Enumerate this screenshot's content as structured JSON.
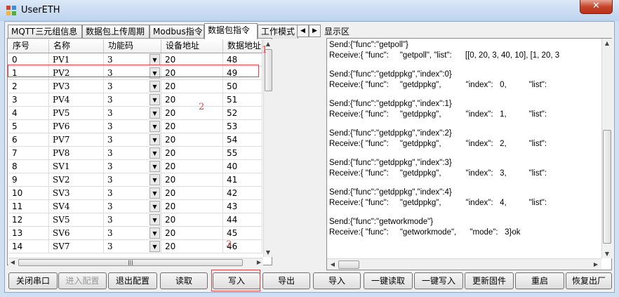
{
  "window": {
    "title": "UserETH",
    "close_label": "✕"
  },
  "tabs": [
    {
      "label": "MQTT三元组信息"
    },
    {
      "label": "数据包上传周期"
    },
    {
      "label": "Modbus指令"
    },
    {
      "label": "数据包指令",
      "active": true
    },
    {
      "label": "工作模式"
    }
  ],
  "tab_scroll": {
    "left": "◀",
    "right": "▶"
  },
  "grid": {
    "columns": [
      "序号",
      "名称",
      "功能码",
      "设备地址",
      "数据地址"
    ],
    "rows": [
      [
        "0",
        "PV1",
        "3",
        "20",
        "48"
      ],
      [
        "1",
        "PV2",
        "3",
        "20",
        "49"
      ],
      [
        "2",
        "PV3",
        "3",
        "20",
        "50"
      ],
      [
        "3",
        "PV4",
        "3",
        "20",
        "51"
      ],
      [
        "4",
        "PV5",
        "3",
        "20",
        "52"
      ],
      [
        "5",
        "PV6",
        "3",
        "20",
        "53"
      ],
      [
        "6",
        "PV7",
        "3",
        "20",
        "54"
      ],
      [
        "7",
        "PV8",
        "3",
        "20",
        "55"
      ],
      [
        "8",
        "SV1",
        "3",
        "20",
        "40"
      ],
      [
        "9",
        "SV2",
        "3",
        "20",
        "41"
      ],
      [
        "10",
        "SV3",
        "3",
        "20",
        "42"
      ],
      [
        "11",
        "SV4",
        "3",
        "20",
        "43"
      ],
      [
        "12",
        "SV5",
        "3",
        "20",
        "44"
      ],
      [
        "13",
        "SV6",
        "3",
        "20",
        "45"
      ],
      [
        "14",
        "SV7",
        "3",
        "20",
        "46"
      ]
    ]
  },
  "annotations": {
    "one": "1",
    "two": "2",
    "three": "3"
  },
  "right_label": "显示区",
  "log": [
    "Send:{\"func\":\"getpoll\"}",
    "Receive:{ \"func\":     \"getpoll\", \"list\":      [[0, 20, 3, 40, 10], [1, 20, 3",
    "",
    "Send:{\"func\":\"getdppkg\",\"index\":0}",
    "Receive:{ \"func\":     \"getdppkg\",           \"index\":   0,          \"list\":",
    "",
    "Send:{\"func\":\"getdppkg\",\"index\":1}",
    "Receive:{ \"func\":     \"getdppkg\",           \"index\":   1,          \"list\":",
    "",
    "Send:{\"func\":\"getdppkg\",\"index\":2}",
    "Receive:{ \"func\":     \"getdppkg\",           \"index\":   2,          \"list\":",
    "",
    "Send:{\"func\":\"getdppkg\",\"index\":3}",
    "Receive:{ \"func\":     \"getdppkg\",           \"index\":   3,          \"list\":",
    "",
    "Send:{\"func\":\"getdppkg\",\"index\":4}",
    "Receive:{ \"func\":     \"getdppkg\",           \"index\":   4,          \"list\":",
    "",
    "Send:{\"func\":\"getworkmode\"}",
    "Receive:{ \"func\":     \"getworkmode\",      \"mode\":   3}ok"
  ],
  "buttons": [
    {
      "label": "关闭串口",
      "name": "close-port-button"
    },
    {
      "label": "进入配置",
      "name": "enter-config-button",
      "disabled": true
    },
    {
      "label": "退出配置",
      "name": "exit-config-button"
    },
    {
      "label": "读取",
      "name": "read-button"
    },
    {
      "label": "写入",
      "name": "write-button"
    },
    {
      "label": "导出",
      "name": "export-button"
    },
    {
      "label": "导入",
      "name": "import-button"
    },
    {
      "label": "一键读取",
      "name": "one-click-read-button"
    },
    {
      "label": "一键写入",
      "name": "one-click-write-button"
    },
    {
      "label": "更新固件",
      "name": "update-firmware-button"
    },
    {
      "label": "重启",
      "name": "restart-button"
    },
    {
      "label": "恢复出厂",
      "name": "factory-reset-button"
    }
  ],
  "colors": {
    "highlight": "#e04444",
    "title_bar": "#c6dcf4"
  }
}
